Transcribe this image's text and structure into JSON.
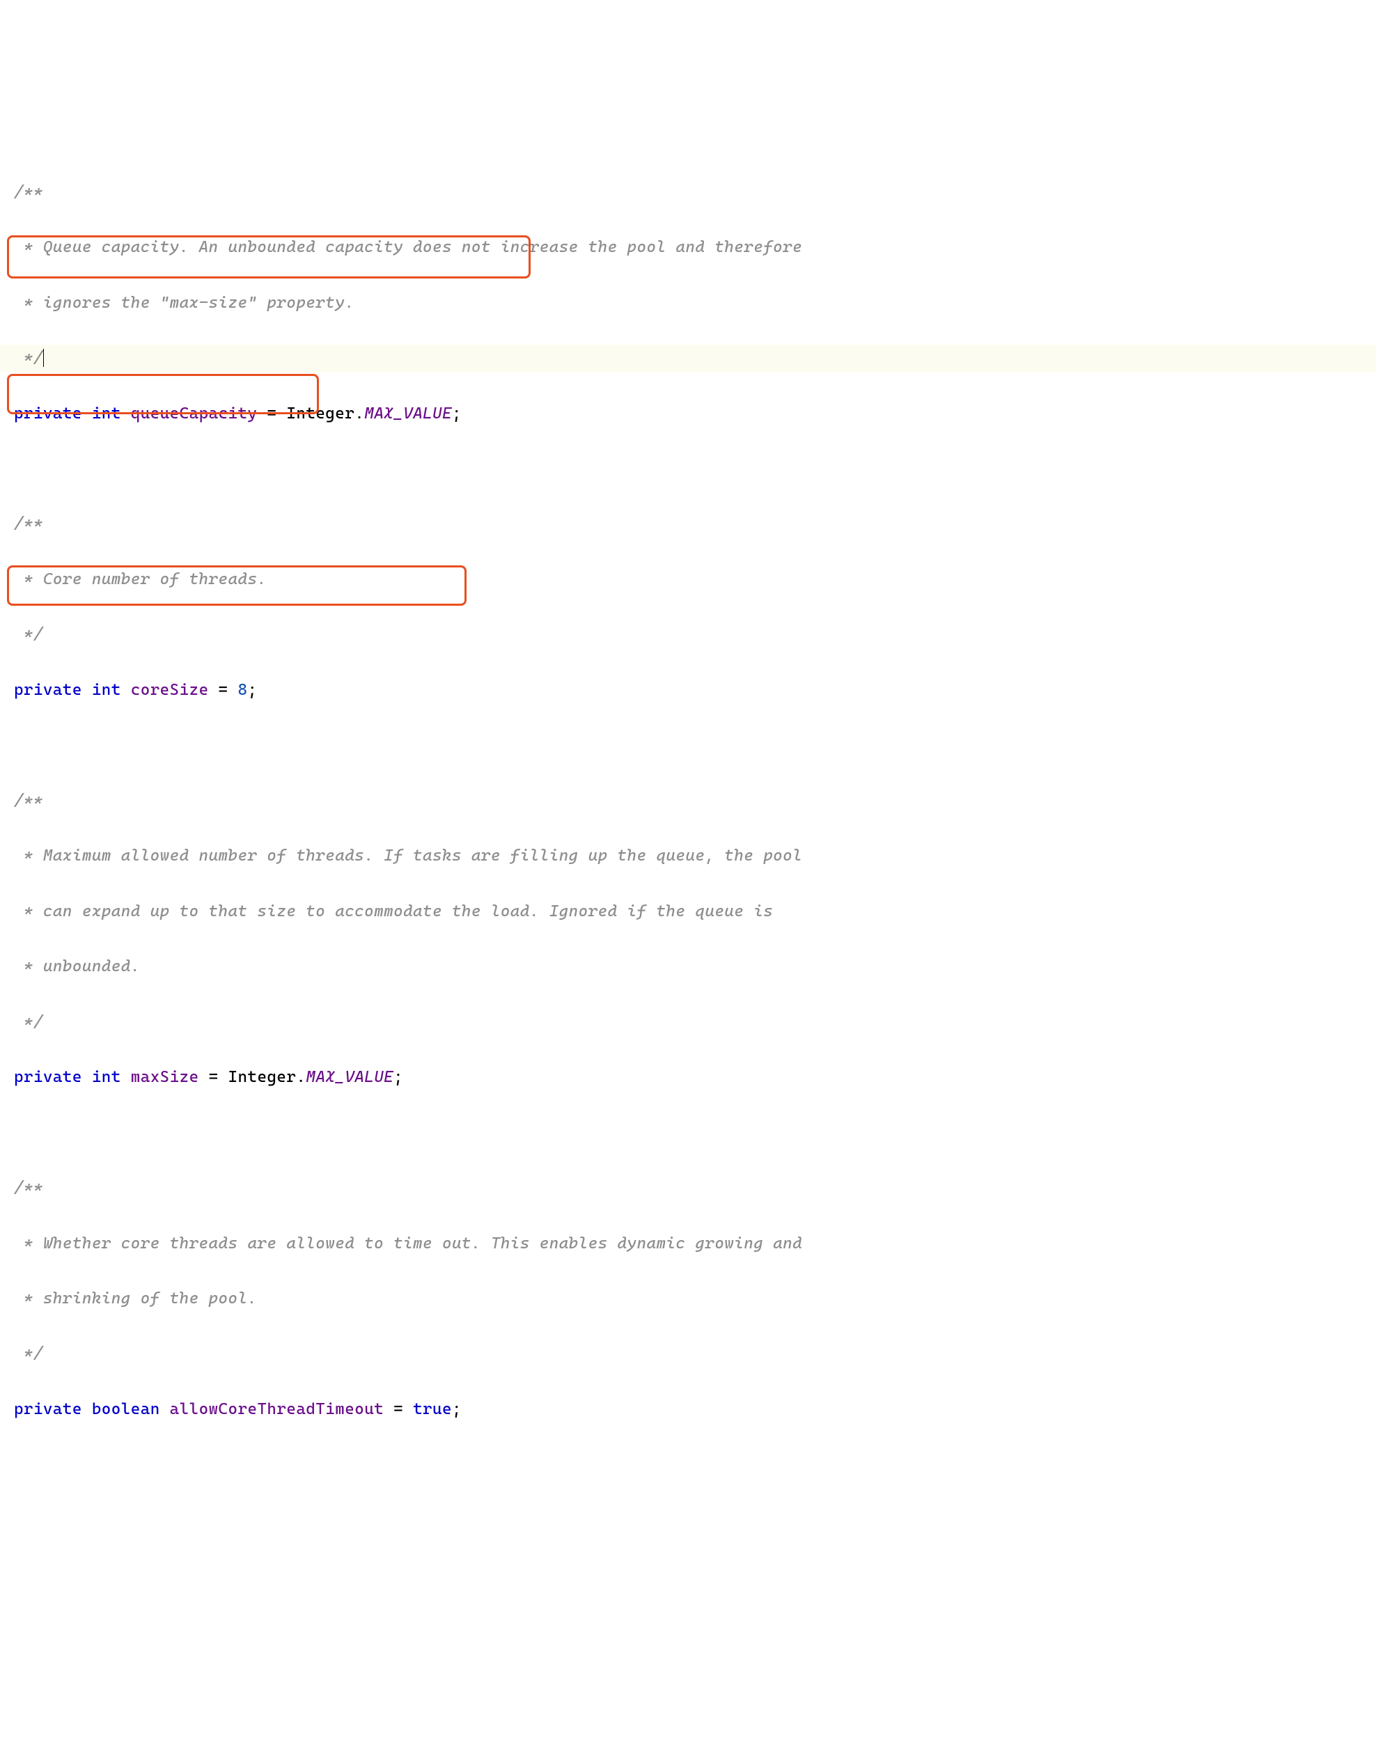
{
  "code": {
    "comment1_open": "/**",
    "comment1_l1": " * Queue capacity. An unbounded capacity does not increase the pool and therefore",
    "comment1_l2": " * ignores the \"max-size\" property.",
    "comment1_close": " */",
    "field1_private": "private",
    "field1_int": "int",
    "field1_name": "queueCapacity",
    "field1_eq": " = ",
    "field1_type": "Integer",
    "field1_dot": ".",
    "field1_const": "MAX_VALUE",
    "field1_semi": ";",
    "comment2_open": "/**",
    "comment2_l1": " * Core number of threads.",
    "comment2_close": " */",
    "field2_private": "private",
    "field2_int": "int",
    "field2_name": "coreSize",
    "field2_eq": " = ",
    "field2_value": "8",
    "field2_semi": ";",
    "comment3_open": "/**",
    "comment3_l1": " * Maximum allowed number of threads. If tasks are filling up the queue, the pool",
    "comment3_l2": " * can expand up to that size to accommodate the load. Ignored if the queue is",
    "comment3_l3": " * unbounded.",
    "comment3_close": " */",
    "field3_private": "private",
    "field3_int": "int",
    "field3_name": "maxSize",
    "field3_eq": " = ",
    "field3_type": "Integer",
    "field3_dot": ".",
    "field3_const": "MAX_VALUE",
    "field3_semi": ";",
    "comment4_open": "/**",
    "comment4_l1": " * Whether core threads are allowed to time out. This enables dynamic growing and",
    "comment4_l2": " * shrinking of the pool.",
    "comment4_close": " */",
    "field4_private": "private",
    "field4_boolean": "boolean",
    "field4_name": "allowCoreThreadTimeout",
    "field4_eq": " = ",
    "field4_value": "true",
    "field4_semi": ";"
  },
  "colors": {
    "highlight_bg": "#fdfcf0",
    "box_border": "#e94f1f",
    "comment": "#8e8e8e",
    "keyword": "#0000c8",
    "field": "#6a0f8a",
    "number": "#1350b8",
    "constant": "#6a0f8a"
  }
}
